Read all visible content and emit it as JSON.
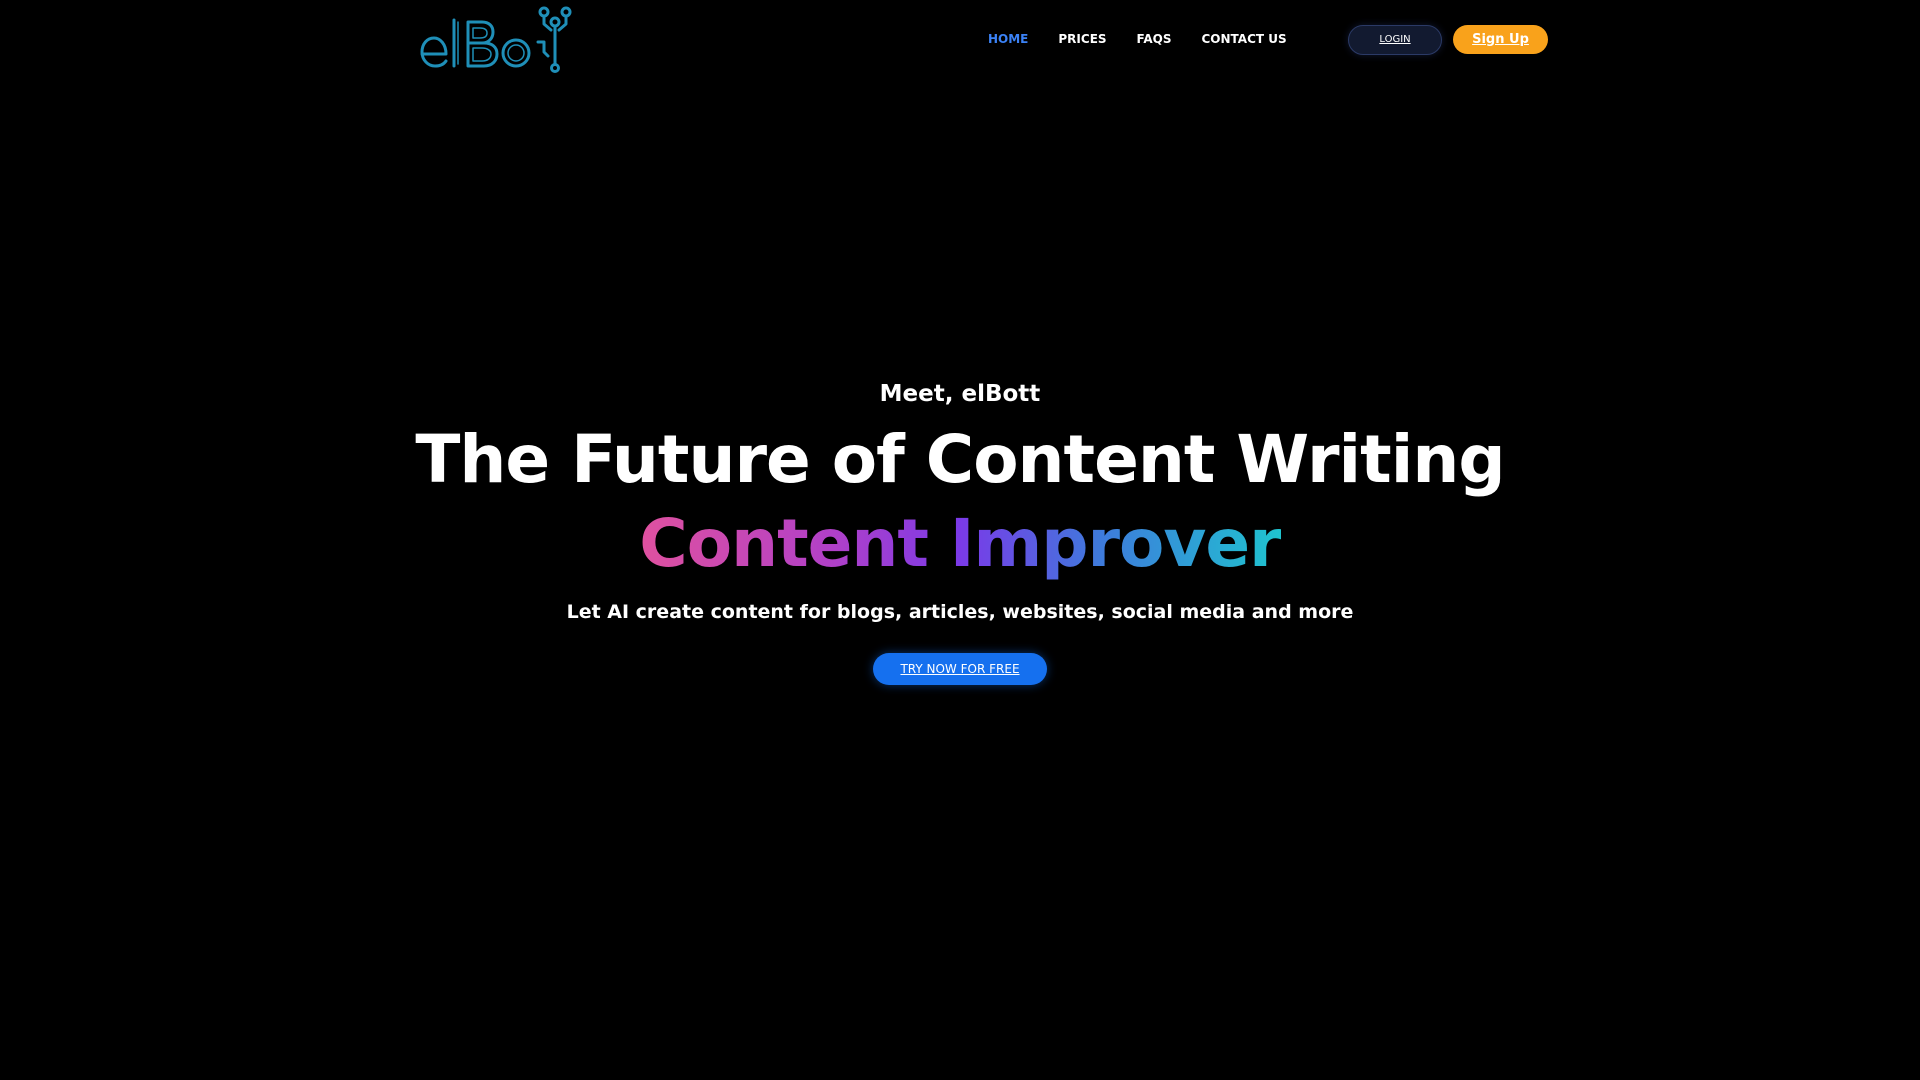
{
  "logo": {
    "icon": "elbot-logo",
    "color": "#1f8fb8"
  },
  "nav": {
    "items": [
      {
        "label": "HOME",
        "active": true
      },
      {
        "label": "PRICES",
        "active": false
      },
      {
        "label": "FAQS",
        "active": false
      },
      {
        "label": "CONTACT US",
        "active": false
      }
    ],
    "active_color": "#3b82f6"
  },
  "auth": {
    "login_label": "LOGIN",
    "signup_label": "Sign Up",
    "signup_color": "#f9a21b"
  },
  "hero": {
    "kicker": "Meet, elBott",
    "headline": "The Future of Content Writing",
    "rotating_text": "Content Improver",
    "gradient_colors": [
      "#e0519f",
      "#7a3ae8",
      "#1fc4cf"
    ],
    "subline": "Let AI create content for blogs, articles, websites, social media and more",
    "cta_label": "TRY NOW FOR FREE",
    "cta_color": "#1570ef"
  }
}
